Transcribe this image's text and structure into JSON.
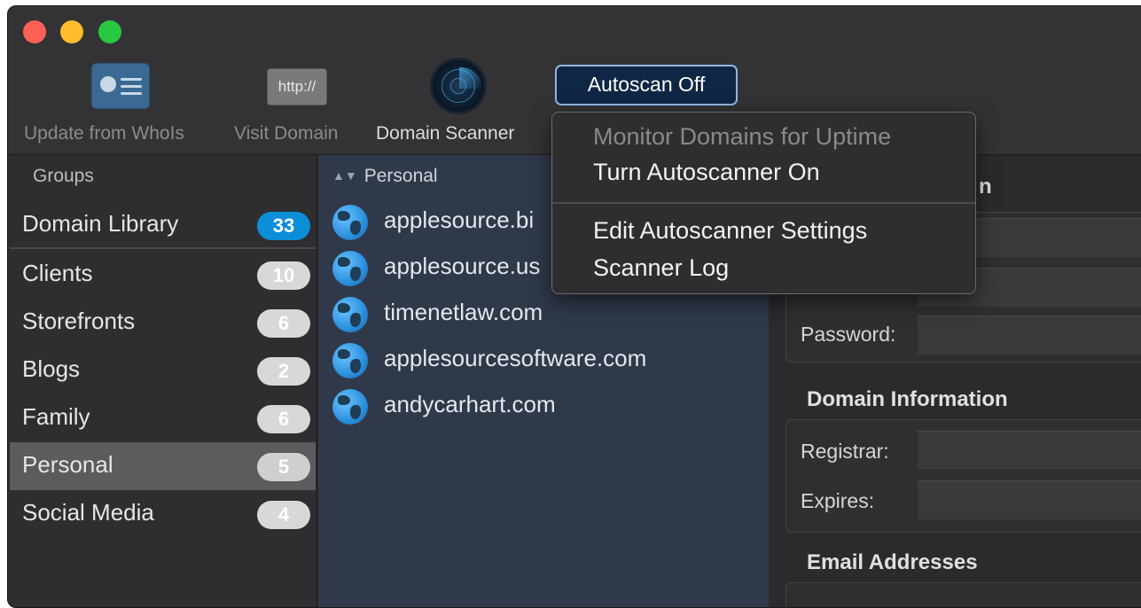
{
  "toolbar": {
    "update_label": "Update from WhoIs",
    "visit_label": "Visit Domain",
    "visit_icon_text": "http://",
    "scanner_label": "Domain Scanner",
    "autoscan_label": "Autoscan Off"
  },
  "sidebar": {
    "header": "Groups",
    "items": [
      {
        "label": "Domain Library",
        "count": "33"
      },
      {
        "label": "Clients",
        "count": "10"
      },
      {
        "label": "Storefronts",
        "count": "6"
      },
      {
        "label": "Blogs",
        "count": "2"
      },
      {
        "label": "Family",
        "count": "6"
      },
      {
        "label": "Personal",
        "count": "5"
      },
      {
        "label": "Social Media",
        "count": "4"
      }
    ],
    "selected": "Personal"
  },
  "list": {
    "header": "Personal",
    "domains": [
      "applesource.bi",
      "applesource.us",
      "timenetlaw.com",
      "applesourcesoftware.com",
      "andycarhart.com"
    ]
  },
  "detail": {
    "partial_title": "n",
    "password_label": "Password:",
    "domain_info_title": "Domain Information",
    "registrar_label": "Registrar:",
    "expires_label": "Expires:",
    "email_title": "Email Addresses"
  },
  "menu": {
    "items": [
      "Monitor Domains for Uptime",
      "Turn Autoscanner On",
      "Edit Autoscanner Settings",
      "Scanner Log"
    ]
  },
  "colors": {
    "badge_blue": "#0b8fd8",
    "autoscan_bg": "#0f2744",
    "list_bg": "#30394a"
  }
}
